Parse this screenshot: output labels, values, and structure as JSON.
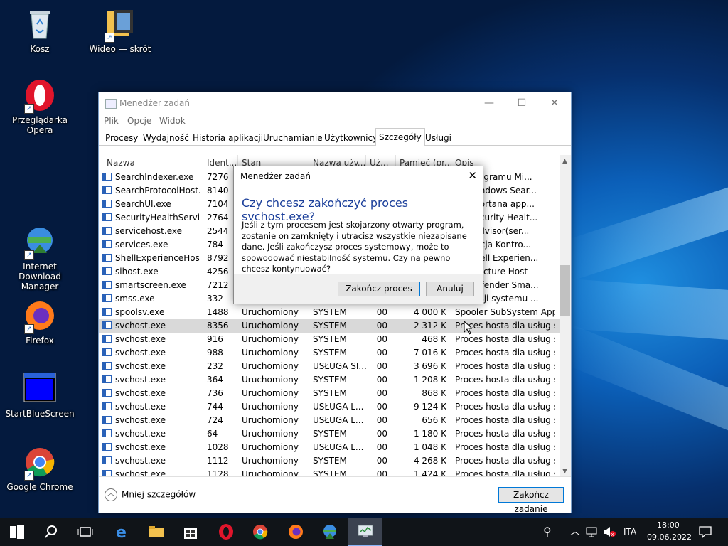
{
  "desktop": {
    "icons": [
      {
        "label": "Kosz",
        "icon": "recycle-bin-icon"
      },
      {
        "label": "Wideo — skrót",
        "icon": "video-folder-icon"
      },
      {
        "label": "Przeglądarka Opera",
        "icon": "opera-icon"
      },
      {
        "label": "Internet Download Manager",
        "icon": "idm-icon"
      },
      {
        "label": "Firefox",
        "icon": "firefox-icon"
      },
      {
        "label": "StartBlueScreen",
        "icon": "bluescreen-window-icon"
      },
      {
        "label": "Google Chrome",
        "icon": "chrome-icon"
      }
    ]
  },
  "taskmgr": {
    "title": "Menedżer zadań",
    "menu": [
      "Plik",
      "Opcje",
      "Widok"
    ],
    "tabs": [
      "Procesy",
      "Wydajność",
      "Historia aplikacji",
      "Uruchamianie",
      "Użytkownicy",
      "Szczegóły",
      "Usługi"
    ],
    "active_tab": "Szczegóły",
    "columns": [
      "Nazwa",
      "Ident...",
      "Stan",
      "Nazwa uży...",
      "Uż...",
      "Pamięć (pr...",
      "Opis"
    ],
    "rows": [
      {
        "name": "SearchIndexer.exe",
        "pid": "7276",
        "status": "",
        "user": "",
        "cpu": "",
        "mem": "",
        "desc": "tor programu Mi..."
      },
      {
        "name": "SearchProtocolHost....",
        "pid": "8140",
        "status": "",
        "user": "",
        "cpu": "",
        "mem": "",
        "desc": "oft Windows Sear..."
      },
      {
        "name": "SearchUI.exe",
        "pid": "7104",
        "status": "",
        "user": "",
        "cpu": "",
        "mem": "",
        "desc": "and Cortana app..."
      },
      {
        "name": "SecurityHealthServic...",
        "pid": "2764",
        "status": "",
        "user": "",
        "cpu": "",
        "mem": "",
        "desc": "ws Security Healt..."
      },
      {
        "name": "servicehost.exe",
        "pid": "2544",
        "status": "",
        "user": "",
        "cpu": "",
        "mem": "",
        "desc": "WebAdvisor(ser..."
      },
      {
        "name": "services.exe",
        "pid": "784",
        "status": "",
        "user": "",
        "cpu": "",
        "mem": "",
        "desc": "aplikacja Kontro..."
      },
      {
        "name": "ShellExperienceHost....",
        "pid": "8792",
        "status": "",
        "user": "",
        "cpu": "",
        "mem": "",
        "desc": "ws Shell Experien..."
      },
      {
        "name": "sihost.exe",
        "pid": "4256",
        "status": "",
        "user": "",
        "cpu": "",
        "mem": "",
        "desc": "frastructure Host"
      },
      {
        "name": "smartscreen.exe",
        "pid": "7212",
        "status": "",
        "user": "",
        "cpu": "",
        "mem": "",
        "desc": "ws Defender Sma..."
      },
      {
        "name": "smss.exe",
        "pid": "332",
        "status": "",
        "user": "",
        "cpu": "",
        "mem": "",
        "desc": "ter sesji systemu ..."
      },
      {
        "name": "spoolsv.exe",
        "pid": "1488",
        "status": "Uruchomiony",
        "user": "SYSTEM",
        "cpu": "00",
        "mem": "4 000 K",
        "desc": "Spooler SubSystem App"
      },
      {
        "name": "svchost.exe",
        "pid": "8356",
        "status": "Uruchomiony",
        "user": "SYSTEM",
        "cpu": "00",
        "mem": "2 312 K",
        "desc": "Proces hosta dla usług s..."
      },
      {
        "name": "svchost.exe",
        "pid": "916",
        "status": "Uruchomiony",
        "user": "SYSTEM",
        "cpu": "00",
        "mem": "468 K",
        "desc": "Proces hosta dla usług s..."
      },
      {
        "name": "svchost.exe",
        "pid": "988",
        "status": "Uruchomiony",
        "user": "SYSTEM",
        "cpu": "00",
        "mem": "7 016 K",
        "desc": "Proces hosta dla usług s..."
      },
      {
        "name": "svchost.exe",
        "pid": "232",
        "status": "Uruchomiony",
        "user": "USŁUGA SI...",
        "cpu": "00",
        "mem": "3 696 K",
        "desc": "Proces hosta dla usług s..."
      },
      {
        "name": "svchost.exe",
        "pid": "364",
        "status": "Uruchomiony",
        "user": "SYSTEM",
        "cpu": "00",
        "mem": "1 208 K",
        "desc": "Proces hosta dla usług s..."
      },
      {
        "name": "svchost.exe",
        "pid": "736",
        "status": "Uruchomiony",
        "user": "SYSTEM",
        "cpu": "00",
        "mem": "868 K",
        "desc": "Proces hosta dla usług s..."
      },
      {
        "name": "svchost.exe",
        "pid": "744",
        "status": "Uruchomiony",
        "user": "USŁUGA L...",
        "cpu": "00",
        "mem": "9 124 K",
        "desc": "Proces hosta dla usług s..."
      },
      {
        "name": "svchost.exe",
        "pid": "724",
        "status": "Uruchomiony",
        "user": "USŁUGA L...",
        "cpu": "00",
        "mem": "656 K",
        "desc": "Proces hosta dla usług s..."
      },
      {
        "name": "svchost.exe",
        "pid": "64",
        "status": "Uruchomiony",
        "user": "SYSTEM",
        "cpu": "00",
        "mem": "1 180 K",
        "desc": "Proces hosta dla usług s..."
      },
      {
        "name": "svchost.exe",
        "pid": "1028",
        "status": "Uruchomiony",
        "user": "USŁUGA L...",
        "cpu": "00",
        "mem": "1 048 K",
        "desc": "Proces hosta dla usług s..."
      },
      {
        "name": "svchost.exe",
        "pid": "1112",
        "status": "Uruchomiony",
        "user": "SYSTEM",
        "cpu": "00",
        "mem": "4 268 K",
        "desc": "Proces hosta dla usług s..."
      },
      {
        "name": "svchost.exe",
        "pid": "1128",
        "status": "Uruchomiony",
        "user": "SYSTEM",
        "cpu": "00",
        "mem": "1 424 K",
        "desc": "Proces hosta dla usług s..."
      }
    ],
    "selected_row": 11,
    "fewer_details": "Mniej szczegółów",
    "end_task": "Zakończ zadanie"
  },
  "dialog": {
    "title": "Menedżer zadań",
    "question": "Czy chcesz zakończyć proces svchost.exe?",
    "message": "Jeśli z tym procesem jest skojarzony otwarty program, zostanie on zamknięty i utracisz wszystkie niezapisane dane. Jeśli zakończysz proces systemowy, może to spowodować niestabilność systemu. Czy na pewno chcesz kontynuować?",
    "confirm": "Zakończ proces",
    "cancel": "Anuluj"
  },
  "taskbar": {
    "apps": [
      "start-icon",
      "search-icon",
      "task-view-icon",
      "edge-icon",
      "file-explorer-icon",
      "store-icon",
      "opera-icon",
      "chrome-icon",
      "firefox-icon",
      "idm-icon",
      "task-manager-icon"
    ],
    "language": "ITA",
    "time": "18:00",
    "date": "09.06.2022"
  }
}
